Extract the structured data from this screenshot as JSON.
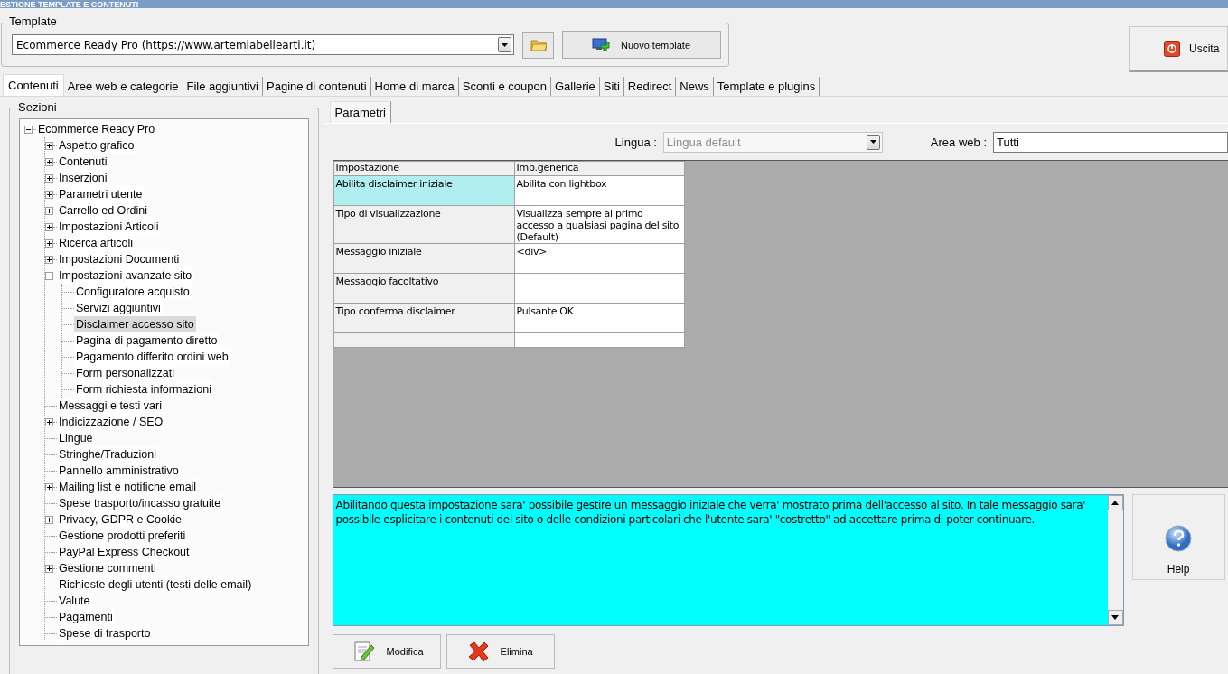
{
  "window": {
    "title": "ESTIONE TEMPLATE E CONTENUTI"
  },
  "template": {
    "label": "Template",
    "value": "Ecommerce Ready Pro (https://www.artemiabellearti.it)",
    "new_button": "Nuovo template"
  },
  "exit_button": "Uscita",
  "tabs": [
    {
      "label": "Contenuti",
      "selected": true
    },
    {
      "label": "Aree web e categorie",
      "selected": false
    },
    {
      "label": "File aggiuntivi",
      "selected": false
    },
    {
      "label": "Pagine di contenuti",
      "selected": false
    },
    {
      "label": "Home di marca",
      "selected": false
    },
    {
      "label": "Sconti e coupon",
      "selected": false
    },
    {
      "label": "Gallerie",
      "selected": false
    },
    {
      "label": "Siti",
      "selected": false
    },
    {
      "label": "Redirect",
      "selected": false
    },
    {
      "label": "News",
      "selected": false
    },
    {
      "label": "Template e plugins",
      "selected": false
    }
  ],
  "sections": {
    "label": "Sezioni",
    "tree": [
      {
        "label": "Ecommerce Ready Pro",
        "expanded": true,
        "selected": false,
        "children": [
          {
            "label": "Aspetto grafico",
            "expanded": false,
            "selected": false
          },
          {
            "label": "Contenuti",
            "expanded": false,
            "selected": false
          },
          {
            "label": "Inserzioni",
            "expanded": false,
            "selected": false
          },
          {
            "label": "Parametri utente",
            "expanded": false,
            "selected": false
          },
          {
            "label": "Carrello ed Ordini",
            "expanded": false,
            "selected": false
          },
          {
            "label": "Impostazioni Articoli",
            "expanded": false,
            "selected": false
          },
          {
            "label": "Ricerca articoli",
            "expanded": false,
            "selected": false
          },
          {
            "label": "Impostazioni Documenti",
            "expanded": false,
            "selected": false
          },
          {
            "label": "Impostazioni avanzate sito",
            "expanded": true,
            "selected": false,
            "children": [
              {
                "label": "Configuratore acquisto",
                "selected": false
              },
              {
                "label": "Servizi aggiuntivi",
                "selected": false
              },
              {
                "label": "Disclaimer accesso sito",
                "selected": true
              },
              {
                "label": "Pagina di pagamento diretto",
                "selected": false
              },
              {
                "label": "Pagamento differito ordini web",
                "selected": false
              },
              {
                "label": "Form personalizzati",
                "selected": false
              },
              {
                "label": "Form richiesta informazioni",
                "selected": false
              }
            ]
          },
          {
            "label": "Messaggi e testi vari",
            "selected": false
          },
          {
            "label": "Indicizzazione / SEO",
            "expanded": false,
            "selected": false
          },
          {
            "label": "Lingue",
            "selected": false
          },
          {
            "label": "Stringhe/Traduzioni",
            "selected": false
          },
          {
            "label": "Pannello amministrativo",
            "selected": false
          },
          {
            "label": "Mailing list e notifiche email",
            "expanded": false,
            "selected": false
          },
          {
            "label": "Spese trasporto/incasso gratuite",
            "selected": false
          },
          {
            "label": "Privacy, GDPR e Cookie",
            "expanded": false,
            "selected": false
          },
          {
            "label": "Gestione prodotti preferiti",
            "selected": false
          },
          {
            "label": "PayPal Express Checkout",
            "selected": false
          },
          {
            "label": "Gestione commenti",
            "expanded": false,
            "selected": false
          },
          {
            "label": "Richieste degli utenti (testi delle email)",
            "selected": false
          },
          {
            "label": "Valute",
            "selected": false
          },
          {
            "label": "Pagamenti",
            "selected": false
          },
          {
            "label": "Spese di trasporto",
            "selected": false
          }
        ]
      }
    ]
  },
  "subtabs": [
    {
      "label": "Parametri",
      "selected": true
    }
  ],
  "filters": {
    "language_label": "Lingua :",
    "language_value": "Lingua default",
    "language_disabled": true,
    "area_label": "Area web :",
    "area_value": "Tutti"
  },
  "table": {
    "columns": [
      "Impostazione",
      "Imp.generica"
    ],
    "rows": [
      {
        "setting": "Abilita disclaimer iniziale",
        "value": "Abilita con lightbox",
        "selected": true
      },
      {
        "setting": "Tipo di visualizzazione",
        "value": "Visualizza sempre al primo accesso a qualsiasi pagina del sito (Default)",
        "selected": false
      },
      {
        "setting": "Messaggio iniziale",
        "value": "<div>",
        "selected": false
      },
      {
        "setting": "Messaggio facoltativo",
        "selected": false
      },
      {
        "setting": "Tipo conferma disclaimer",
        "value": "Pulsante OK",
        "selected": false
      },
      {
        "selected": false
      }
    ]
  },
  "description": "Abilitando questa impostazione sara' possibile gestire un messaggio iniziale che verra' mostrato prima dell'accesso al sito. In tale messaggio sara' possibile esplicitare i contenuti del sito o delle condizioni particolari che l'utente sara' \"costretto\" ad accettare prima di poter continuare.",
  "help_button": "Help",
  "buttons": [
    {
      "kind": "edit",
      "label": "Modifica"
    },
    {
      "kind": "delete",
      "label": "Elimina"
    }
  ]
}
